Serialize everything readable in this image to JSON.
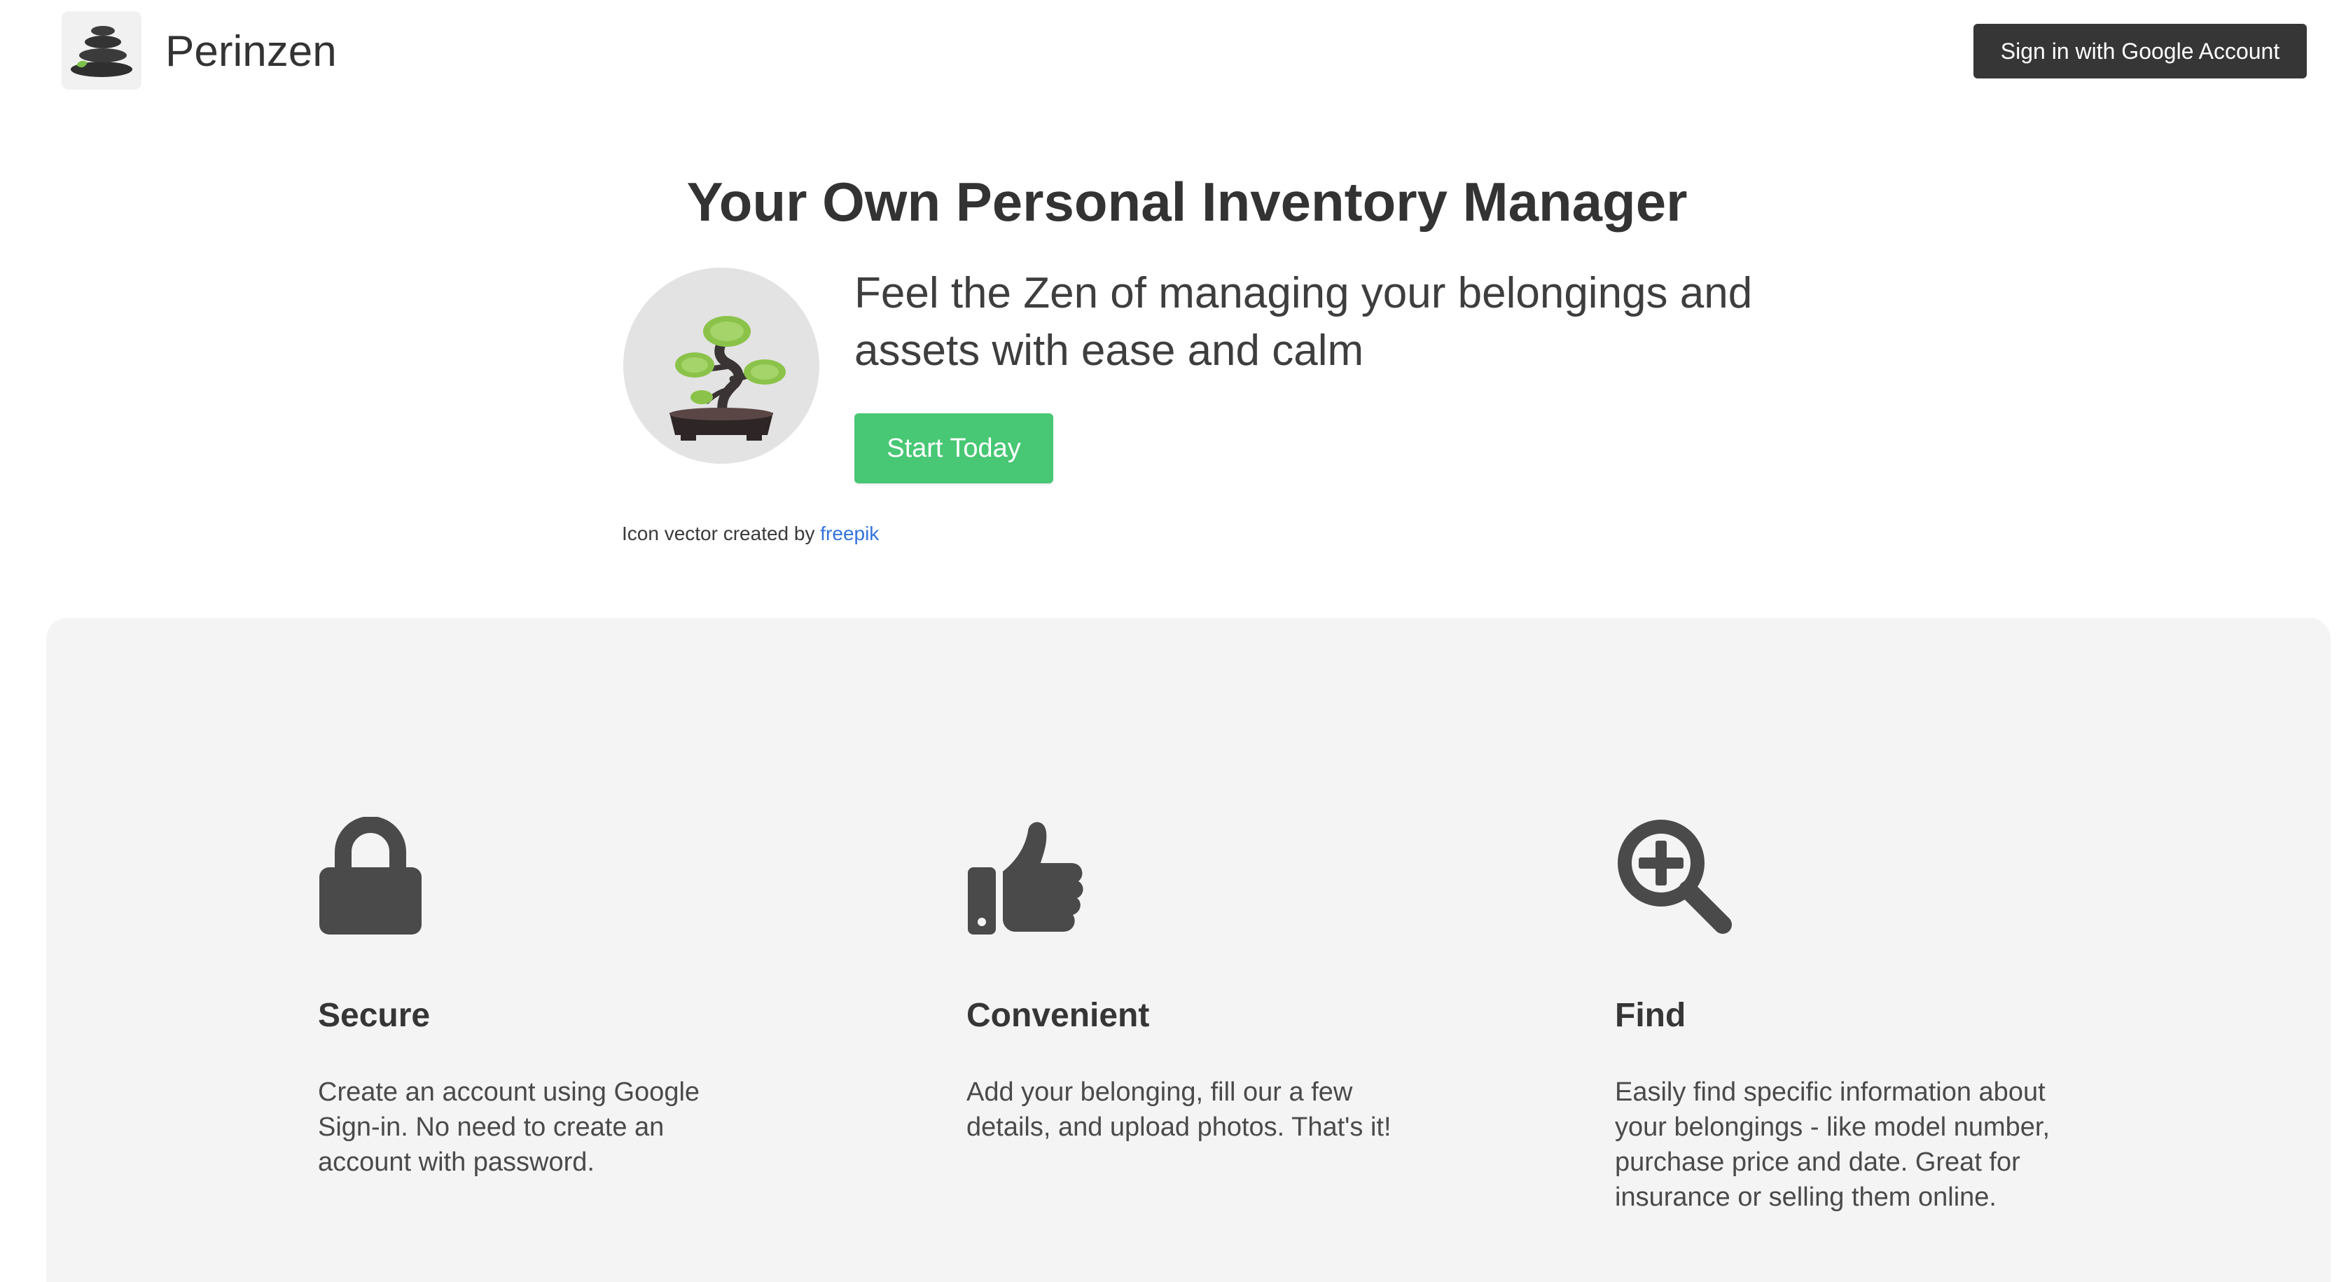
{
  "header": {
    "brand": "Perinzen",
    "logo_icon": "zen-stones-icon",
    "signin_label": "Sign in with Google Account"
  },
  "hero": {
    "title": "Your Own Personal Inventory Manager",
    "illustration_icon": "bonsai-icon",
    "tagline": "Feel the Zen of managing your belongings and assets with ease and calm",
    "cta_label": "Start Today",
    "credit_prefix": "Icon vector created by",
    "credit_link": "freepik"
  },
  "features": [
    {
      "icon": "lock-icon",
      "title": "Secure",
      "text": "Create an account using Google Sign-in. No need to create an account with password."
    },
    {
      "icon": "thumbs-up-icon",
      "title": "Convenient",
      "text": "Add your belonging, fill our a few details, and upload photos. That's it!"
    },
    {
      "icon": "search-plus-icon",
      "title": "Find",
      "text": "Easily find specific information about your belongings - like model number, purchase price and date. Great for insurance or selling them online."
    }
  ],
  "colors": {
    "accent_green": "#48c774",
    "dark_button": "#363636",
    "link_blue": "#3273dc",
    "feature_bg": "#f4f4f4",
    "icon_gray": "#4a4a4a"
  }
}
